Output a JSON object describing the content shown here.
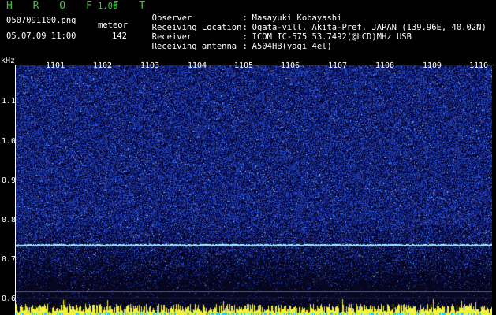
{
  "header": {
    "app_title": "H R O F F T",
    "app_version": "1.00",
    "file_name": "0507091100.png",
    "meteor_label": "meteor",
    "meteor_count": "142",
    "date_time": "05.07.09 11:00"
  },
  "info": [
    {
      "key": "Observer",
      "value": "Masayuki Kobayashi"
    },
    {
      "key": "Receiving Location",
      "value": "Ogata-vill. Akita-Pref. JAPAN (139.96E, 40.02N)"
    },
    {
      "key": "Receiver",
      "value": "ICOM IC-575 53.7492(@LCD)MHz USB"
    },
    {
      "key": "Receiving antenna",
      "value": "A504HB(yagi 4el)"
    }
  ],
  "axis": {
    "y_unit": "kHz",
    "y_ticks": [
      "1.1",
      "1.0",
      "0.9",
      "0.8",
      "0.7",
      "0.6"
    ],
    "x_ticks": [
      "1101",
      "1102",
      "1103",
      "1104",
      "1105",
      "1106",
      "1107",
      "1108",
      "1109",
      "1110"
    ]
  },
  "colors": {
    "title_green": "#3ec43e",
    "background": "#000000",
    "spectrum_deep": "#080828",
    "spectrum_noise": "#2a3cff",
    "trace": "#9ff2ff",
    "signal_bar": "#f2f23a"
  }
}
